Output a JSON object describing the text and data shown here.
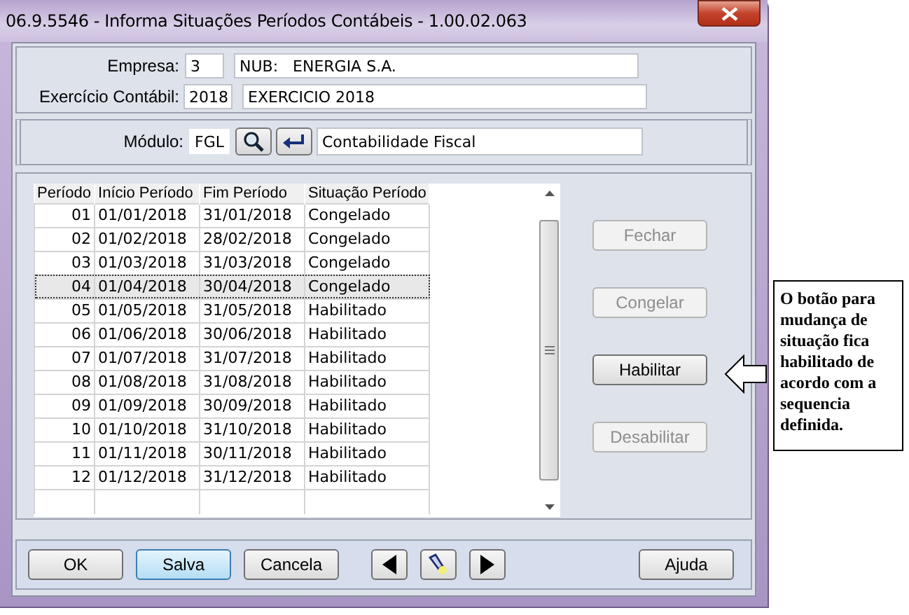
{
  "window": {
    "title": "06.9.5546 - Informa Situações Períodos Contábeis - 1.00.02.063"
  },
  "header": {
    "fields": [
      {
        "label": "Empresa:",
        "code": "3",
        "description": "NUB:   ENERGIA S.A."
      },
      {
        "label": "Exercício Contábil:",
        "code": "2018",
        "description": "EXERCICIO 2018"
      }
    ]
  },
  "module": {
    "label": "Módulo:",
    "code": "FGL",
    "description": "Contabilidade Fiscal"
  },
  "table": {
    "columns": [
      "Período",
      "Início Período",
      "Fim Período",
      "Situação Período"
    ],
    "rows": [
      {
        "cells": [
          "01",
          "01/01/2018",
          "31/01/2018",
          "Congelado"
        ],
        "selected": false
      },
      {
        "cells": [
          "02",
          "01/02/2018",
          "28/02/2018",
          "Congelado"
        ],
        "selected": false
      },
      {
        "cells": [
          "03",
          "01/03/2018",
          "31/03/2018",
          "Congelado"
        ],
        "selected": false
      },
      {
        "cells": [
          "04",
          "01/04/2018",
          "30/04/2018",
          "Congelado"
        ],
        "selected": true
      },
      {
        "cells": [
          "05",
          "01/05/2018",
          "31/05/2018",
          "Habilitado"
        ],
        "selected": false
      },
      {
        "cells": [
          "06",
          "01/06/2018",
          "30/06/2018",
          "Habilitado"
        ],
        "selected": false
      },
      {
        "cells": [
          "07",
          "01/07/2018",
          "31/07/2018",
          "Habilitado"
        ],
        "selected": false
      },
      {
        "cells": [
          "08",
          "01/08/2018",
          "31/08/2018",
          "Habilitado"
        ],
        "selected": false
      },
      {
        "cells": [
          "09",
          "01/09/2018",
          "30/09/2018",
          "Habilitado"
        ],
        "selected": false
      },
      {
        "cells": [
          "10",
          "01/10/2018",
          "31/10/2018",
          "Habilitado"
        ],
        "selected": false
      },
      {
        "cells": [
          "11",
          "01/11/2018",
          "30/11/2018",
          "Habilitado"
        ],
        "selected": false
      },
      {
        "cells": [
          "12",
          "01/12/2018",
          "31/12/2018",
          "Habilitado"
        ],
        "selected": false
      }
    ]
  },
  "side_buttons": [
    {
      "label": "Fechar",
      "disabled": true
    },
    {
      "label": "Congelar",
      "disabled": true
    },
    {
      "label": "Habilitar",
      "disabled": false
    },
    {
      "label": "Desabilitar",
      "disabled": true
    }
  ],
  "bottom_buttons": [
    {
      "kind": "text",
      "label": "OK",
      "focused": false
    },
    {
      "kind": "text",
      "label": "Salva",
      "focused": true
    },
    {
      "kind": "text",
      "label": "Cancela",
      "focused": false
    },
    {
      "kind": "previous"
    },
    {
      "kind": "find"
    },
    {
      "kind": "next"
    },
    {
      "kind": "text",
      "label": "Ajuda",
      "focused": false
    }
  ],
  "annotation": {
    "text": "O botão para mudança de situação fica habilitado de acordo com a sequencia definida."
  }
}
